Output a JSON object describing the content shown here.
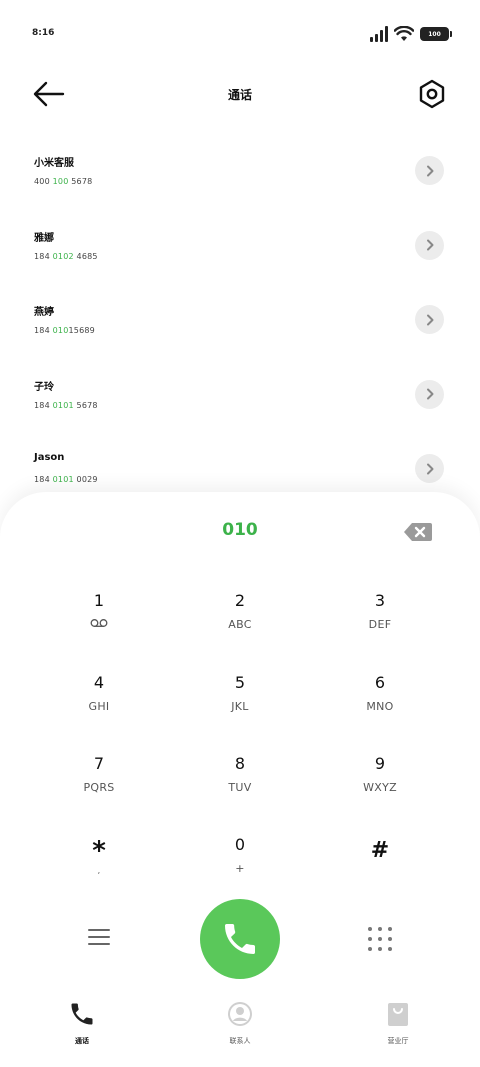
{
  "status_bar": {
    "time": "8:16",
    "battery": "100",
    "icons": [
      "signal-icon",
      "wifi-icon",
      "battery-icon"
    ]
  },
  "header": {
    "title": "通话",
    "back_icon": "arrow-left-icon",
    "settings_icon": "settings-hexagon-icon"
  },
  "calls": [
    {
      "name": "小米客服",
      "pre": "400 ",
      "match": "100",
      "post": " 5678"
    },
    {
      "name": "雅娜",
      "pre": "184 ",
      "match": "0102",
      "post": " 4685"
    },
    {
      "name": "燕婷",
      "pre": "184 ",
      "match": "010",
      "post": "15689"
    },
    {
      "name": "子玲",
      "pre": "184 ",
      "match": "0101",
      "post": " 5678"
    },
    {
      "name": "Jason",
      "pre": "184 ",
      "match": "0101",
      "post": " 0029"
    }
  ],
  "dialer": {
    "input": "010",
    "keys": [
      {
        "digit": "1",
        "letters": ""
      },
      {
        "digit": "2",
        "letters": "ABC"
      },
      {
        "digit": "3",
        "letters": "DEF"
      },
      {
        "digit": "4",
        "letters": "GHI"
      },
      {
        "digit": "5",
        "letters": "JKL"
      },
      {
        "digit": "6",
        "letters": "MNO"
      },
      {
        "digit": "7",
        "letters": "PQRS"
      },
      {
        "digit": "8",
        "letters": "TUV"
      },
      {
        "digit": "9",
        "letters": "WXYZ"
      },
      {
        "digit": "*",
        "letters": ","
      },
      {
        "digit": "0",
        "letters": "+"
      },
      {
        "digit": "#",
        "letters": ""
      }
    ]
  },
  "tabs": [
    {
      "label": "通话",
      "icon": "phone-icon",
      "active": true
    },
    {
      "label": "联系人",
      "icon": "contact-icon",
      "active": false
    },
    {
      "label": "营业厅",
      "icon": "shopping-bag-icon",
      "active": false
    }
  ],
  "colors": {
    "accent": "#3cb24a",
    "call_button": "#5ac85a"
  }
}
